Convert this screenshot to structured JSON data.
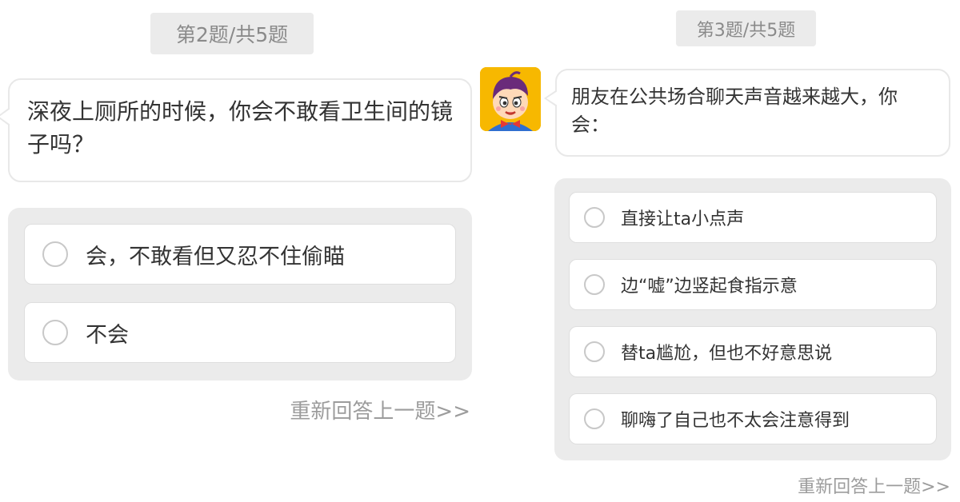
{
  "left_panel": {
    "progress": "第2题/共5题",
    "question": "深夜上厕所的时候，你会不敢看卫生间的镜子吗？",
    "options": [
      {
        "label": "会，不敢看但又忍不住偷瞄"
      },
      {
        "label": "不会"
      }
    ],
    "redo_link": "重新回答上一题>>"
  },
  "right_panel": {
    "progress": "第3题/共5题",
    "avatar_icon": "cartoon-boy-icon",
    "question": "朋友在公共场合聊天声音越来越大，你会：",
    "options": [
      {
        "label": "直接让ta小点声"
      },
      {
        "label": "边“嘘”边竖起食指示意"
      },
      {
        "label": "替ta尴尬，但也不好意思说"
      },
      {
        "label": "聊嗨了自己也不太会注意得到"
      }
    ],
    "redo_link": "重新回答上一题>>"
  },
  "colors": {
    "background": "#ffffff",
    "progress_badge_bg": "#ebebeb",
    "options_panel_bg": "#ebebeb",
    "text": "#333333",
    "muted_text": "#9c9c9c",
    "avatar_bg": "#f7b800"
  }
}
